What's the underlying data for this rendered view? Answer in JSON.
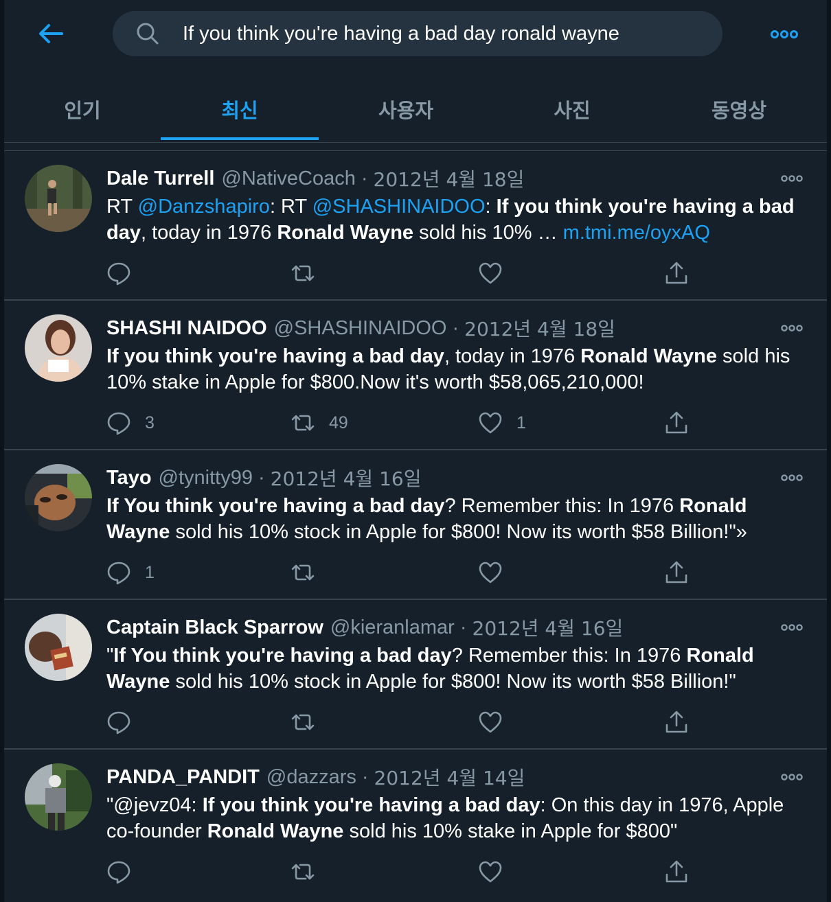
{
  "search": {
    "query": "If you think you're having a bad day ronald wayne"
  },
  "tabs": [
    {
      "label": "인기"
    },
    {
      "label": "최신"
    },
    {
      "label": "사용자"
    },
    {
      "label": "사진"
    },
    {
      "label": "동영상"
    }
  ],
  "active_tab": "최신",
  "colors": {
    "background": "#15202b",
    "accent": "#1da1f2",
    "muted": "#8899a6",
    "divider": "#38444d"
  },
  "icons": [
    "back-arrow-icon",
    "search-icon",
    "more-icon",
    "reply-icon",
    "retweet-icon",
    "like-icon",
    "share-icon"
  ],
  "tweets": [
    {
      "name": "Dale Turrell",
      "handle": "@NativeCoach",
      "sep": "·",
      "date": "2012년 4월 18일",
      "segments": [
        {
          "t": "RT "
        },
        {
          "t": "@Danzshapiro",
          "k": "mention"
        },
        {
          "t": ": RT "
        },
        {
          "t": "@SHASHINAIDOO",
          "k": "mention"
        },
        {
          "t": ": "
        },
        {
          "t": "If you think you're having a bad day",
          "k": "bold"
        },
        {
          "t": ", today in 1976 "
        },
        {
          "t": "Ronald Wayne",
          "k": "bold"
        },
        {
          "t": " sold his 10% … "
        },
        {
          "t": "m.tmi.me/oyxAQ",
          "k": "link"
        }
      ],
      "reply_count": "",
      "retweet_count": "",
      "like_count": ""
    },
    {
      "name": "SHASHI NAIDOO",
      "handle": "@SHASHINAIDOO",
      "sep": "·",
      "date": "2012년 4월 18일",
      "segments": [
        {
          "t": "If you think you're having a bad day",
          "k": "bold"
        },
        {
          "t": ", today in 1976 "
        },
        {
          "t": "Ronald Wayne",
          "k": "bold"
        },
        {
          "t": " sold his 10% stake in Apple for $800.Now it's worth $58,065,210,000!"
        }
      ],
      "reply_count": "3",
      "retweet_count": "49",
      "like_count": "1"
    },
    {
      "name": "Tayo",
      "handle": "@tynitty99",
      "sep": "·",
      "date": "2012년 4월 16일",
      "segments": [
        {
          "t": "If You think you're having a bad day",
          "k": "bold"
        },
        {
          "t": "? Remember this: In 1976 "
        },
        {
          "t": "Ronald Wayne",
          "k": "bold"
        },
        {
          "t": " sold his 10% stock in Apple for $800! Now its worth $58 Billion!\"»"
        }
      ],
      "reply_count": "1",
      "retweet_count": "",
      "like_count": ""
    },
    {
      "name": "Captain Black Sparrow",
      "handle": "@kieranlamar",
      "sep": "·",
      "date": "2012년 4월 16일",
      "segments": [
        {
          "t": "\""
        },
        {
          "t": "If You think you're having a bad day",
          "k": "bold"
        },
        {
          "t": "? Remember this: In 1976 "
        },
        {
          "t": "Ronald Wayne",
          "k": "bold"
        },
        {
          "t": " sold his 10% stock in Apple for $800! Now its worth $58 Billion!\""
        }
      ],
      "reply_count": "",
      "retweet_count": "",
      "like_count": ""
    },
    {
      "name": "PANDA_PANDIT",
      "handle": "@dazzars",
      "sep": "·",
      "date": "2012년 4월 14일",
      "segments": [
        {
          "t": "\"@jevz04: "
        },
        {
          "t": "If you think you're having a bad day",
          "k": "bold"
        },
        {
          "t": ": On this day in 1976, Apple co-founder "
        },
        {
          "t": "Ronald Wayne",
          "k": "bold"
        },
        {
          "t": " sold his 10% stake in Apple for $800\""
        }
      ],
      "reply_count": "",
      "retweet_count": "",
      "like_count": ""
    }
  ]
}
